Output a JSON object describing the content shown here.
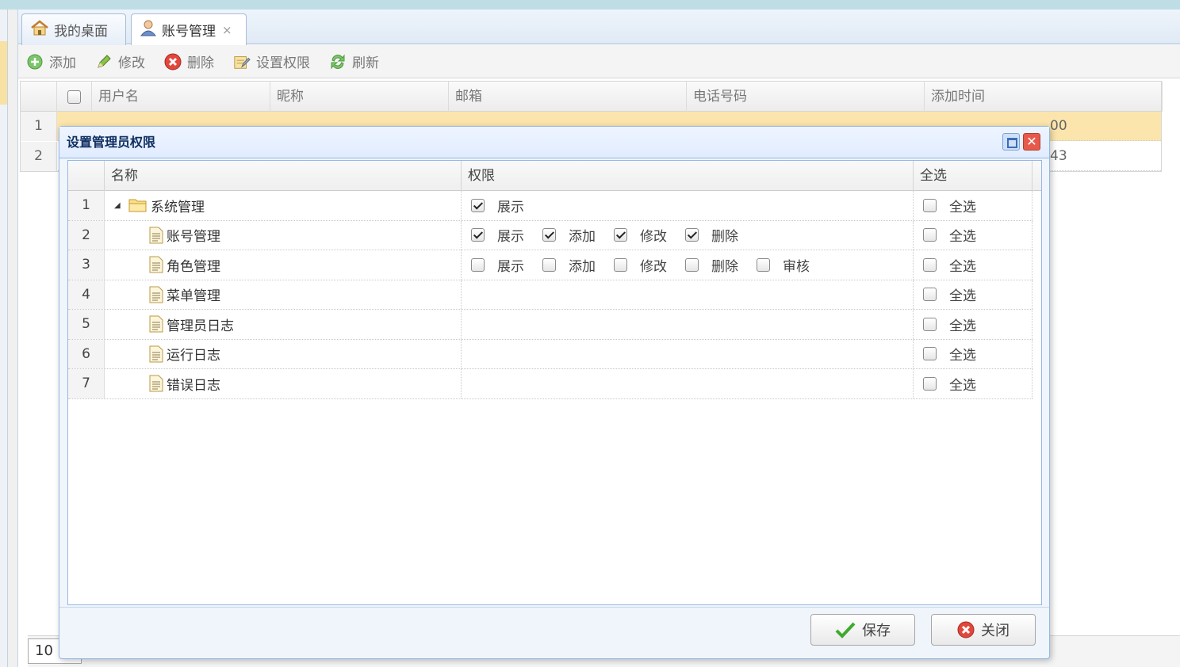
{
  "tabs": [
    {
      "label": "我的桌面",
      "icon": "home-icon"
    },
    {
      "label": "账号管理",
      "icon": "user-icon",
      "close": "×"
    }
  ],
  "toolbar": {
    "add": "添加",
    "edit": "修改",
    "delete": "删除",
    "permissions": "设置权限",
    "refresh": "刷新"
  },
  "grid": {
    "columns": [
      "用户名",
      "昵称",
      "邮箱",
      "电话号码",
      "添加时间"
    ],
    "rows": [
      {
        "num": "1",
        "partial": "00"
      },
      {
        "num": "2",
        "partial": "43"
      }
    ]
  },
  "pager": {
    "page_size": "10"
  },
  "dialog": {
    "title": "设置管理员权限",
    "close_glyph": "✕",
    "columns": {
      "name": "名称",
      "permission": "权限",
      "select_all": "全选"
    },
    "rows": [
      {
        "num": "1",
        "name": "系统管理",
        "type": "folder",
        "expanded": "◢",
        "perms": [
          {
            "label": "展示",
            "checked": true
          }
        ],
        "all": "全选",
        "all_checked": false
      },
      {
        "num": "2",
        "name": "账号管理",
        "type": "leaf",
        "perms": [
          {
            "label": "展示",
            "checked": true
          },
          {
            "label": "添加",
            "checked": true
          },
          {
            "label": "修改",
            "checked": true
          },
          {
            "label": "删除",
            "checked": true
          }
        ],
        "all": "全选",
        "all_checked": false
      },
      {
        "num": "3",
        "name": "角色管理",
        "type": "leaf",
        "perms": [
          {
            "label": "展示",
            "checked": false
          },
          {
            "label": "添加",
            "checked": false
          },
          {
            "label": "修改",
            "checked": false
          },
          {
            "label": "删除",
            "checked": false
          },
          {
            "label": "审核",
            "checked": false
          }
        ],
        "all": "全选",
        "all_checked": false
      },
      {
        "num": "4",
        "name": "菜单管理",
        "type": "leaf",
        "perms": [],
        "all": "全选",
        "all_checked": false
      },
      {
        "num": "5",
        "name": "管理员日志",
        "type": "leaf",
        "perms": [],
        "all": "全选",
        "all_checked": false
      },
      {
        "num": "6",
        "name": "运行日志",
        "type": "leaf",
        "perms": [],
        "all": "全选",
        "all_checked": false
      },
      {
        "num": "7",
        "name": "错误日志",
        "type": "leaf",
        "perms": [],
        "all": "全选",
        "all_checked": false
      }
    ],
    "save": "保存",
    "close": "关闭"
  }
}
